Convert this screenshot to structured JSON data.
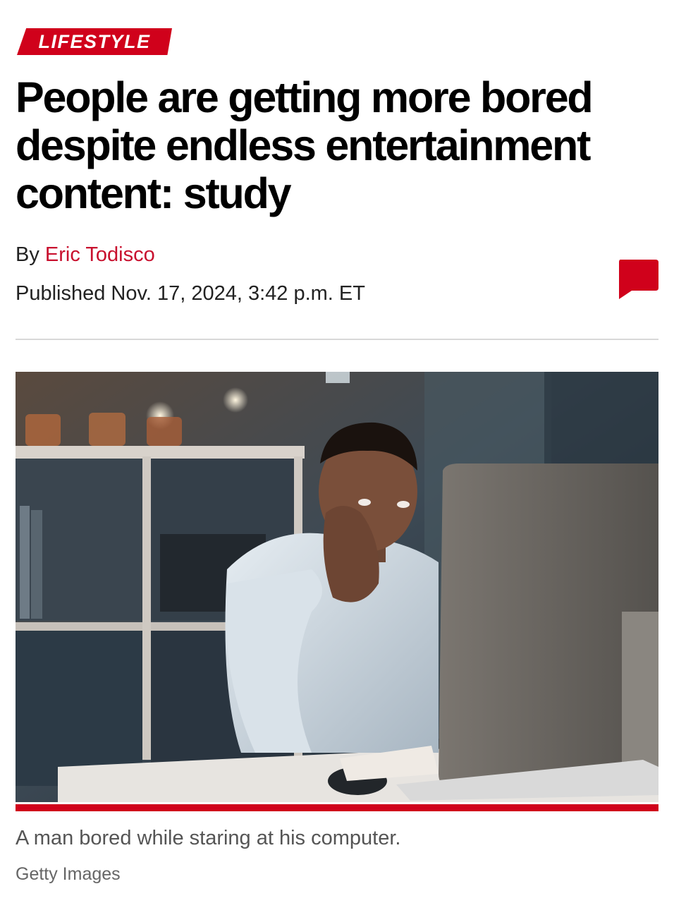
{
  "article": {
    "section": "LIFESTYLE",
    "headline": "People are getting more bored despite endless entertainment content: study",
    "byline_prefix": "By",
    "author": "Eric Todisco",
    "published": "Published Nov. 17, 2024, 3:42 p.m. ET"
  },
  "comments": {
    "icon": "comment-bubble-icon"
  },
  "photo": {
    "caption": "A man bored while staring at his computer.",
    "credit": "Getty Images"
  },
  "colors": {
    "brand_red": "#d0011b",
    "author_red": "#c8102e"
  }
}
